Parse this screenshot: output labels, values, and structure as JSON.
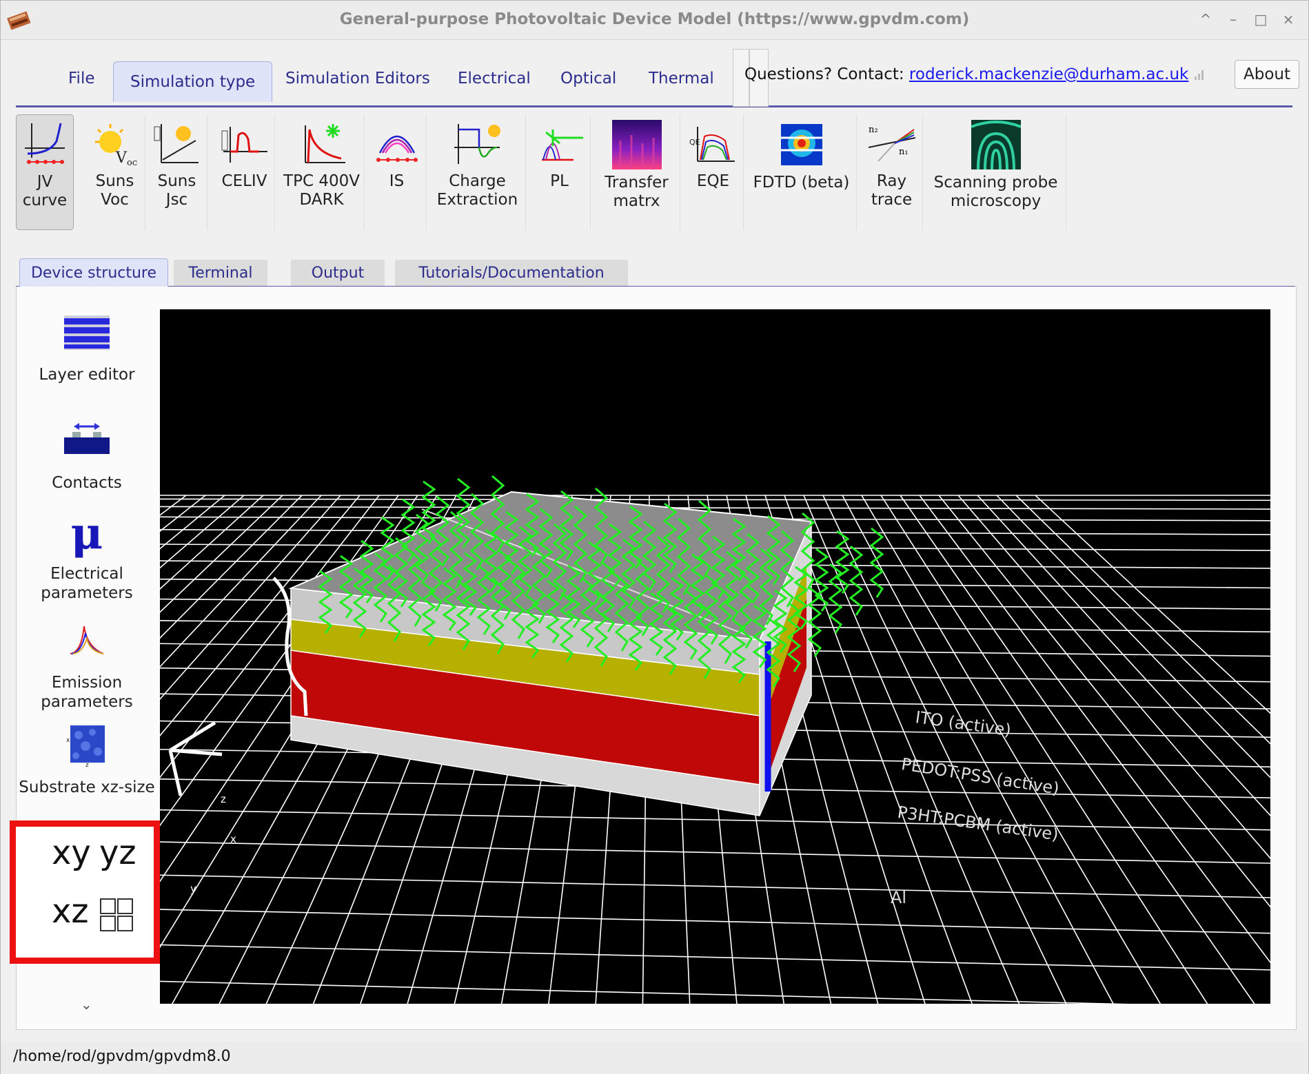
{
  "window": {
    "title": "General-purpose Photovoltaic Device Model (https://www.gpvdm.com)",
    "controls": [
      "^",
      "–",
      "□",
      "×"
    ]
  },
  "tabs": {
    "items": [
      "File",
      "Simulation type",
      "Simulation Editors",
      "Electrical",
      "Optical",
      "Thermal"
    ],
    "active": "Simulation type",
    "contact_prefix": "Questions? Contact: ",
    "contact_email": "roderick.mackenzie@durham.ac.uk",
    "about_label": "About"
  },
  "toolbar": {
    "items": [
      {
        "label": "JV\ncurve",
        "icon": "jv-curve-icon",
        "selected": true
      },
      {
        "label": "Suns\nVoc",
        "icon": "suns-voc-icon"
      },
      {
        "label": "Suns\nJsc",
        "icon": "suns-jsc-icon"
      },
      {
        "label": "CELIV",
        "icon": "celiv-icon"
      },
      {
        "label": "TPC 400V\nDARK",
        "icon": "tpc-icon"
      },
      {
        "label": "IS",
        "icon": "impedance-icon"
      },
      {
        "label": "Charge\nExtraction",
        "icon": "charge-extraction-icon"
      },
      {
        "label": "PL",
        "icon": "pl-icon"
      },
      {
        "label": "Transfer\nmatrx",
        "icon": "transfer-matrix-icon"
      },
      {
        "label": "EQE",
        "icon": "eqe-icon"
      },
      {
        "label": "FDTD (beta)",
        "icon": "fdtd-icon"
      },
      {
        "label": "Ray\ntrace",
        "icon": "ray-trace-icon"
      },
      {
        "label": "Scanning probe\nmicroscopy",
        "icon": "scanning-probe-icon"
      }
    ]
  },
  "subtabs": {
    "items": [
      "Device structure",
      "Terminal",
      "Output",
      "Tutorials/Documentation"
    ],
    "active": "Device structure"
  },
  "sidebar": {
    "items": [
      {
        "label": "Layer\neditor",
        "icon": "layers-icon"
      },
      {
        "label": "Contacts",
        "icon": "contacts-icon"
      },
      {
        "label": "Electrical\nparameters",
        "icon": "mu-icon"
      },
      {
        "label": "Emission\nparameters",
        "icon": "emission-icon"
      },
      {
        "label": "Substrate\nxz-size",
        "icon": "substrate-icon"
      }
    ],
    "view_buttons": [
      "xy",
      "yz",
      "xz"
    ]
  },
  "view3d": {
    "layers": [
      "ITO (active)",
      "PEDOT:PSS (active)",
      "P3HT:PCBM (active)",
      "Al"
    ],
    "axis_labels": [
      "z",
      "x",
      "y"
    ],
    "colors": {
      "ito": "#c8c8c8",
      "pedot": "#b8b000",
      "p3ht": "#c00808",
      "al": "#d8d8d8",
      "photon": "#22ee22",
      "contact": "#1010ee"
    }
  },
  "statusbar": {
    "path": "/home/rod/gpvdm/gpvdm8.0"
  }
}
